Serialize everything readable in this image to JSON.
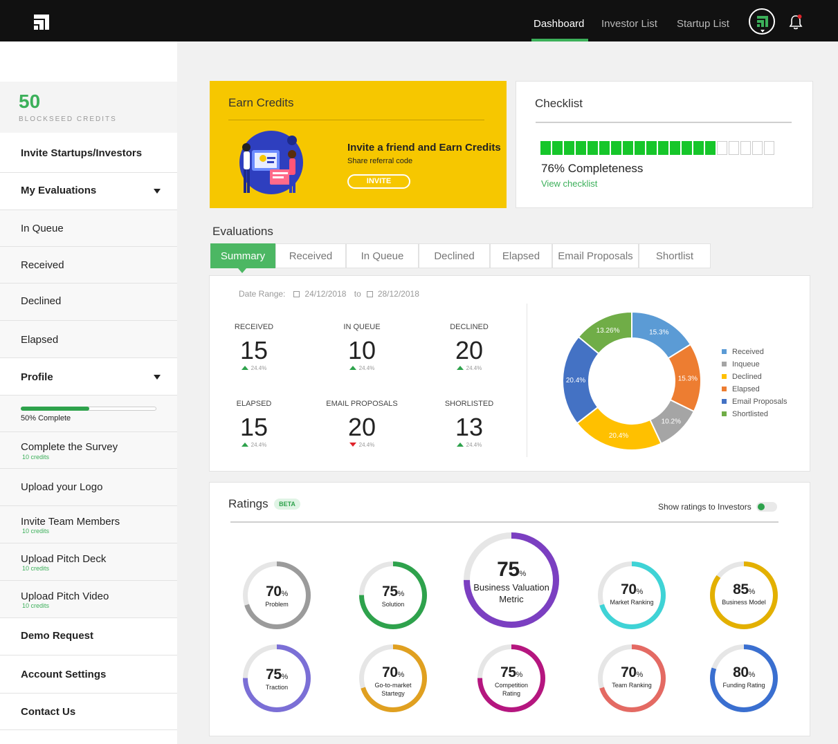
{
  "nav": {
    "items": [
      {
        "label": "Dashboard",
        "active": true
      },
      {
        "label": "Investor List",
        "active": false
      },
      {
        "label": "Startup List",
        "active": false
      }
    ],
    "icons": {
      "logo": "blockseed-logo-icon",
      "avatar": "user-avatar-icon",
      "bell": "bell-icon"
    },
    "accent": "#3cb05a"
  },
  "sidebar": {
    "credits": {
      "value": "50",
      "label": "BLOCKSEED CREDITS"
    },
    "invite": "Invite Startups/Investors",
    "evaluations": {
      "label": "My Evaluations",
      "items": [
        "In Queue",
        "Received",
        "Declined",
        "Elapsed"
      ]
    },
    "profile": {
      "label": "Profile",
      "progress": 0.5,
      "progress_text": "50% Complete"
    },
    "tasks": [
      {
        "label": "Complete the Survey",
        "sub": "10 credits"
      },
      {
        "label": "Upload your Logo",
        "sub": ""
      },
      {
        "label": "Invite Team Members",
        "sub": "10 credits"
      },
      {
        "label": "Upload Pitch Deck",
        "sub": "10 credits"
      },
      {
        "label": "Upload Pitch Video",
        "sub": "10 credits"
      }
    ],
    "demo": "Demo Request",
    "account": "Account Settings",
    "contact": "Contact Us"
  },
  "earn": {
    "title": "Earn Credits",
    "heading": "Invite a friend and Earn Credits",
    "sub": "Share referral code",
    "button": "INVITE",
    "color": "#f6c700"
  },
  "checklist": {
    "title": "Checklist",
    "filled": 15,
    "total": 20,
    "completeness": "76% Completeness",
    "link": "View checklist"
  },
  "evaluations": {
    "title": "Evaluations",
    "tabs": [
      {
        "label": "Summary",
        "active": true
      },
      {
        "label": "Received"
      },
      {
        "label": "In Queue"
      },
      {
        "label": "Declined"
      },
      {
        "label": "Elapsed"
      },
      {
        "label": "Email Proposals"
      },
      {
        "label": "Shortlist"
      }
    ],
    "date_label": "Date Range:",
    "date_from": "24/12/2018",
    "date_to_label": "to",
    "date_to": "28/12/2018",
    "stats": [
      {
        "label": "RECEIVED",
        "value": "15",
        "change": "24.4%",
        "dir": "up"
      },
      {
        "label": "IN QUEUE",
        "value": "10",
        "change": "24.4%",
        "dir": "up"
      },
      {
        "label": "DECLINED",
        "value": "20",
        "change": "24.4%",
        "dir": "up"
      },
      {
        "label": "ELAPSED",
        "value": "15",
        "change": "24.4%",
        "dir": "up"
      },
      {
        "label": "EMAIL PROPOSALS",
        "value": "20",
        "change": "24.4%",
        "dir": "down"
      },
      {
        "label": "SHORLISTED",
        "value": "13",
        "change": "24.4%",
        "dir": "up"
      }
    ]
  },
  "chart_data": {
    "type": "pie",
    "donut": true,
    "categories": [
      "Received",
      "Inqueue",
      "Declined",
      "Elapsed",
      "Email Proposals",
      "Shortlisted"
    ],
    "values": [
      15.3,
      10.2,
      20.4,
      15.3,
      20.4,
      13.26
    ],
    "value_labels": [
      "15.3%",
      "10.2%",
      "20.4%",
      "15.3%",
      "20.4%",
      "13.26%"
    ],
    "slice_order": [
      "Received",
      "Elapsed",
      "Inqueue",
      "Declined",
      "Email Proposals",
      "Shortlisted"
    ],
    "colors": {
      "Received": "#5b9bd5",
      "Inqueue": "#a5a5a5",
      "Declined": "#ffc000",
      "Elapsed": "#ed7d31",
      "Email Proposals": "#4472c4",
      "Shortlisted": "#70ad47"
    },
    "legend": "right"
  },
  "ratings": {
    "title": "Ratings",
    "badge": "BETA",
    "toggle_label": "Show ratings to Investors",
    "toggle_on": true,
    "items": [
      {
        "value": "70",
        "label": "Problem",
        "color": "#9b9b9b"
      },
      {
        "value": "75",
        "label": "Solution",
        "color": "#2ea24c"
      },
      {
        "value": "75",
        "label": "Business Valuation Metric",
        "color": "#7b3fc1"
      },
      {
        "value": "70",
        "label": "Market Ranking",
        "color": "#3fd3d6"
      },
      {
        "value": "85",
        "label": "Business Model",
        "color": "#e3b000"
      },
      {
        "value": "75",
        "label": "Traction",
        "color": "#7b6fd6"
      },
      {
        "value": "70",
        "label": "Go-to-market Startegy",
        "color": "#e0a020"
      },
      {
        "value": "75",
        "label": "Competition Rating",
        "color": "#b5167f"
      },
      {
        "value": "70",
        "label": "Team Ranking",
        "color": "#e46a63"
      },
      {
        "value": "80",
        "label": "Funding Rating",
        "color": "#3a6fd0"
      }
    ]
  }
}
